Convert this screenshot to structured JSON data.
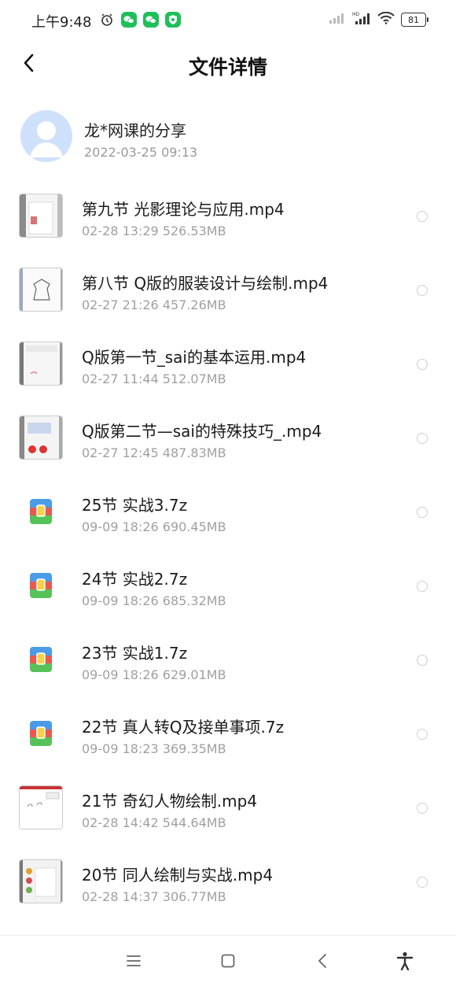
{
  "status_bar": {
    "time": "上午9:48",
    "battery": "81"
  },
  "header": {
    "title": "文件详情"
  },
  "sharer": {
    "name": "龙*网课的分享",
    "time": "2022-03-25  09:13"
  },
  "files": [
    {
      "name": "第九节 光影理论与应用.mp4",
      "meta": "02-28  13:29   526.53MB",
      "type": "video"
    },
    {
      "name": "第八节 Q版的服装设计与绘制.mp4",
      "meta": "02-27  21:26   457.26MB",
      "type": "video"
    },
    {
      "name": "Q版第一节_sai的基本运用.mp4",
      "meta": "02-27  11:44   512.07MB",
      "type": "video"
    },
    {
      "name": "Q版第二节—sai的特殊技巧_.mp4",
      "meta": "02-27  12:45   487.83MB",
      "type": "video"
    },
    {
      "name": "25节  实战3.7z",
      "meta": "09-09  18:26   690.45MB",
      "type": "archive"
    },
    {
      "name": "24节  实战2.7z",
      "meta": "09-09  18:26   685.32MB",
      "type": "archive"
    },
    {
      "name": "23节  实战1.7z",
      "meta": "09-09  18:26   629.01MB",
      "type": "archive"
    },
    {
      "name": "22节 真人转Q及接单事项.7z",
      "meta": "09-09  18:23   369.35MB",
      "type": "archive"
    },
    {
      "name": "21节  奇幻人物绘制.mp4",
      "meta": "02-28  14:42   544.64MB",
      "type": "video"
    },
    {
      "name": "20节 同人绘制与实战.mp4",
      "meta": "02-28  14:37   306.77MB",
      "type": "video"
    }
  ],
  "icons": {
    "back": "chevron-left-icon",
    "archive": "archive-file-icon",
    "nav_menu": "menu-icon",
    "nav_home": "home-icon",
    "nav_back": "back-icon",
    "nav_accessibility": "accessibility-icon"
  },
  "colors": {
    "avatar_bg": "#cfe0fb",
    "meta_text": "#a0a0a0",
    "wechat_green": "#1fbf5a"
  }
}
